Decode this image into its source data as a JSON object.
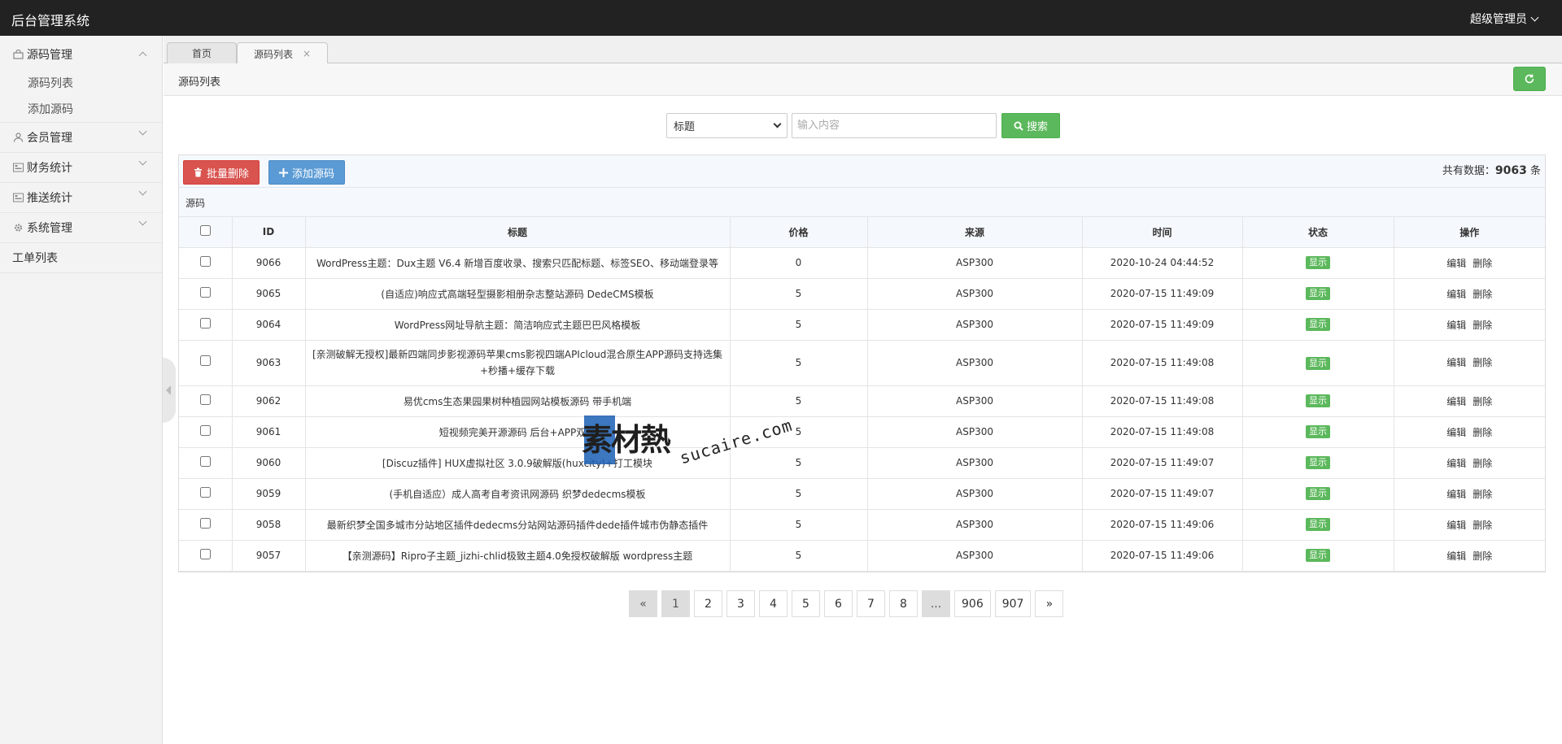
{
  "header": {
    "brand": "后台管理系统",
    "user": "超级管理员"
  },
  "sidebar": {
    "groups": [
      {
        "label": "源码管理",
        "icon": "bag-icon",
        "children": [
          "源码列表",
          "添加源码"
        ]
      },
      {
        "label": "会员管理",
        "icon": "user-icon"
      },
      {
        "label": "财务统计",
        "icon": "chart-icon"
      },
      {
        "label": "推送统计",
        "icon": "chart-icon"
      },
      {
        "label": "系统管理",
        "icon": "gear-icon"
      }
    ],
    "plain": "工单列表"
  },
  "tabs": [
    {
      "label": "首页"
    },
    {
      "label": "源码列表",
      "close": "×"
    }
  ],
  "breadcrumb": "源码列表",
  "search": {
    "field": "标题",
    "placeholder": "输入内容",
    "button": "搜索"
  },
  "toolbar": {
    "delete": "批量删除",
    "add": "添加源码",
    "total_label": "共有数据：",
    "total_value": "9063",
    "total_unit": "条"
  },
  "panel_heading": "源码",
  "table": {
    "columns": [
      "ID",
      "标题",
      "价格",
      "来源",
      "时间",
      "状态",
      "操作"
    ],
    "edit": "编辑",
    "remove": "删除",
    "rows": [
      {
        "id": "9066",
        "title": "WordPress主题：Dux主题 V6.4 新增百度收录、搜索只匹配标题、标签SEO、移动端登录等",
        "price": "0",
        "source": "ASP300",
        "time": "2020-10-24 04:44:52",
        "status": "显示"
      },
      {
        "id": "9065",
        "title": "(自适应)响应式高端轻型摄影相册杂志整站源码 DedeCMS模板",
        "price": "5",
        "source": "ASP300",
        "time": "2020-07-15 11:49:09",
        "status": "显示"
      },
      {
        "id": "9064",
        "title": "WordPress网址导航主题：简洁响应式主题巴巴风格模板",
        "price": "5",
        "source": "ASP300",
        "time": "2020-07-15 11:49:09",
        "status": "显示"
      },
      {
        "id": "9063",
        "title": "[亲测破解无授权]最新四端同步影视源码苹果cms影视四端APIcloud混合原生APP源码支持选集+秒播+缓存下载",
        "price": "5",
        "source": "ASP300",
        "time": "2020-07-15 11:49:08",
        "status": "显示"
      },
      {
        "id": "9062",
        "title": "易优cms生态果园果树种植园网站模板源码 带手机端",
        "price": "5",
        "source": "ASP300",
        "time": "2020-07-15 11:49:08",
        "status": "显示"
      },
      {
        "id": "9061",
        "title": "短视频完美开源源码 后台+APP双端",
        "price": "5",
        "source": "ASP300",
        "time": "2020-07-15 11:49:08",
        "status": "显示"
      },
      {
        "id": "9060",
        "title": "[Discuz插件] HUX虚拟社区 3.0.9破解版(huxcity)+打工模块",
        "price": "5",
        "source": "ASP300",
        "time": "2020-07-15 11:49:07",
        "status": "显示"
      },
      {
        "id": "9059",
        "title": "(手机自适应）成人高考自考资讯网源码 织梦dedecms模板",
        "price": "5",
        "source": "ASP300",
        "time": "2020-07-15 11:49:07",
        "status": "显示"
      },
      {
        "id": "9058",
        "title": "最新织梦全国多城市分站地区插件dedecms分站网站源码插件dede插件城市伪静态插件",
        "price": "5",
        "source": "ASP300",
        "time": "2020-07-15 11:49:06",
        "status": "显示"
      },
      {
        "id": "9057",
        "title": "【亲测源码】Ripro子主题_jizhi-chlid极致主题4.0免授权破解版 wordpress主题",
        "price": "5",
        "source": "ASP300",
        "time": "2020-07-15 11:49:06",
        "status": "显示"
      }
    ]
  },
  "pagination": [
    "«",
    "1",
    "2",
    "3",
    "4",
    "5",
    "6",
    "7",
    "8",
    "...",
    "906",
    "907",
    "»"
  ],
  "watermark": {
    "cn": "素材熱",
    "en": "sucaire.com"
  },
  "colors": {
    "topbar": "#222222",
    "success": "#5cb85c",
    "danger": "#d9534f",
    "primary": "#5b9bd5"
  }
}
